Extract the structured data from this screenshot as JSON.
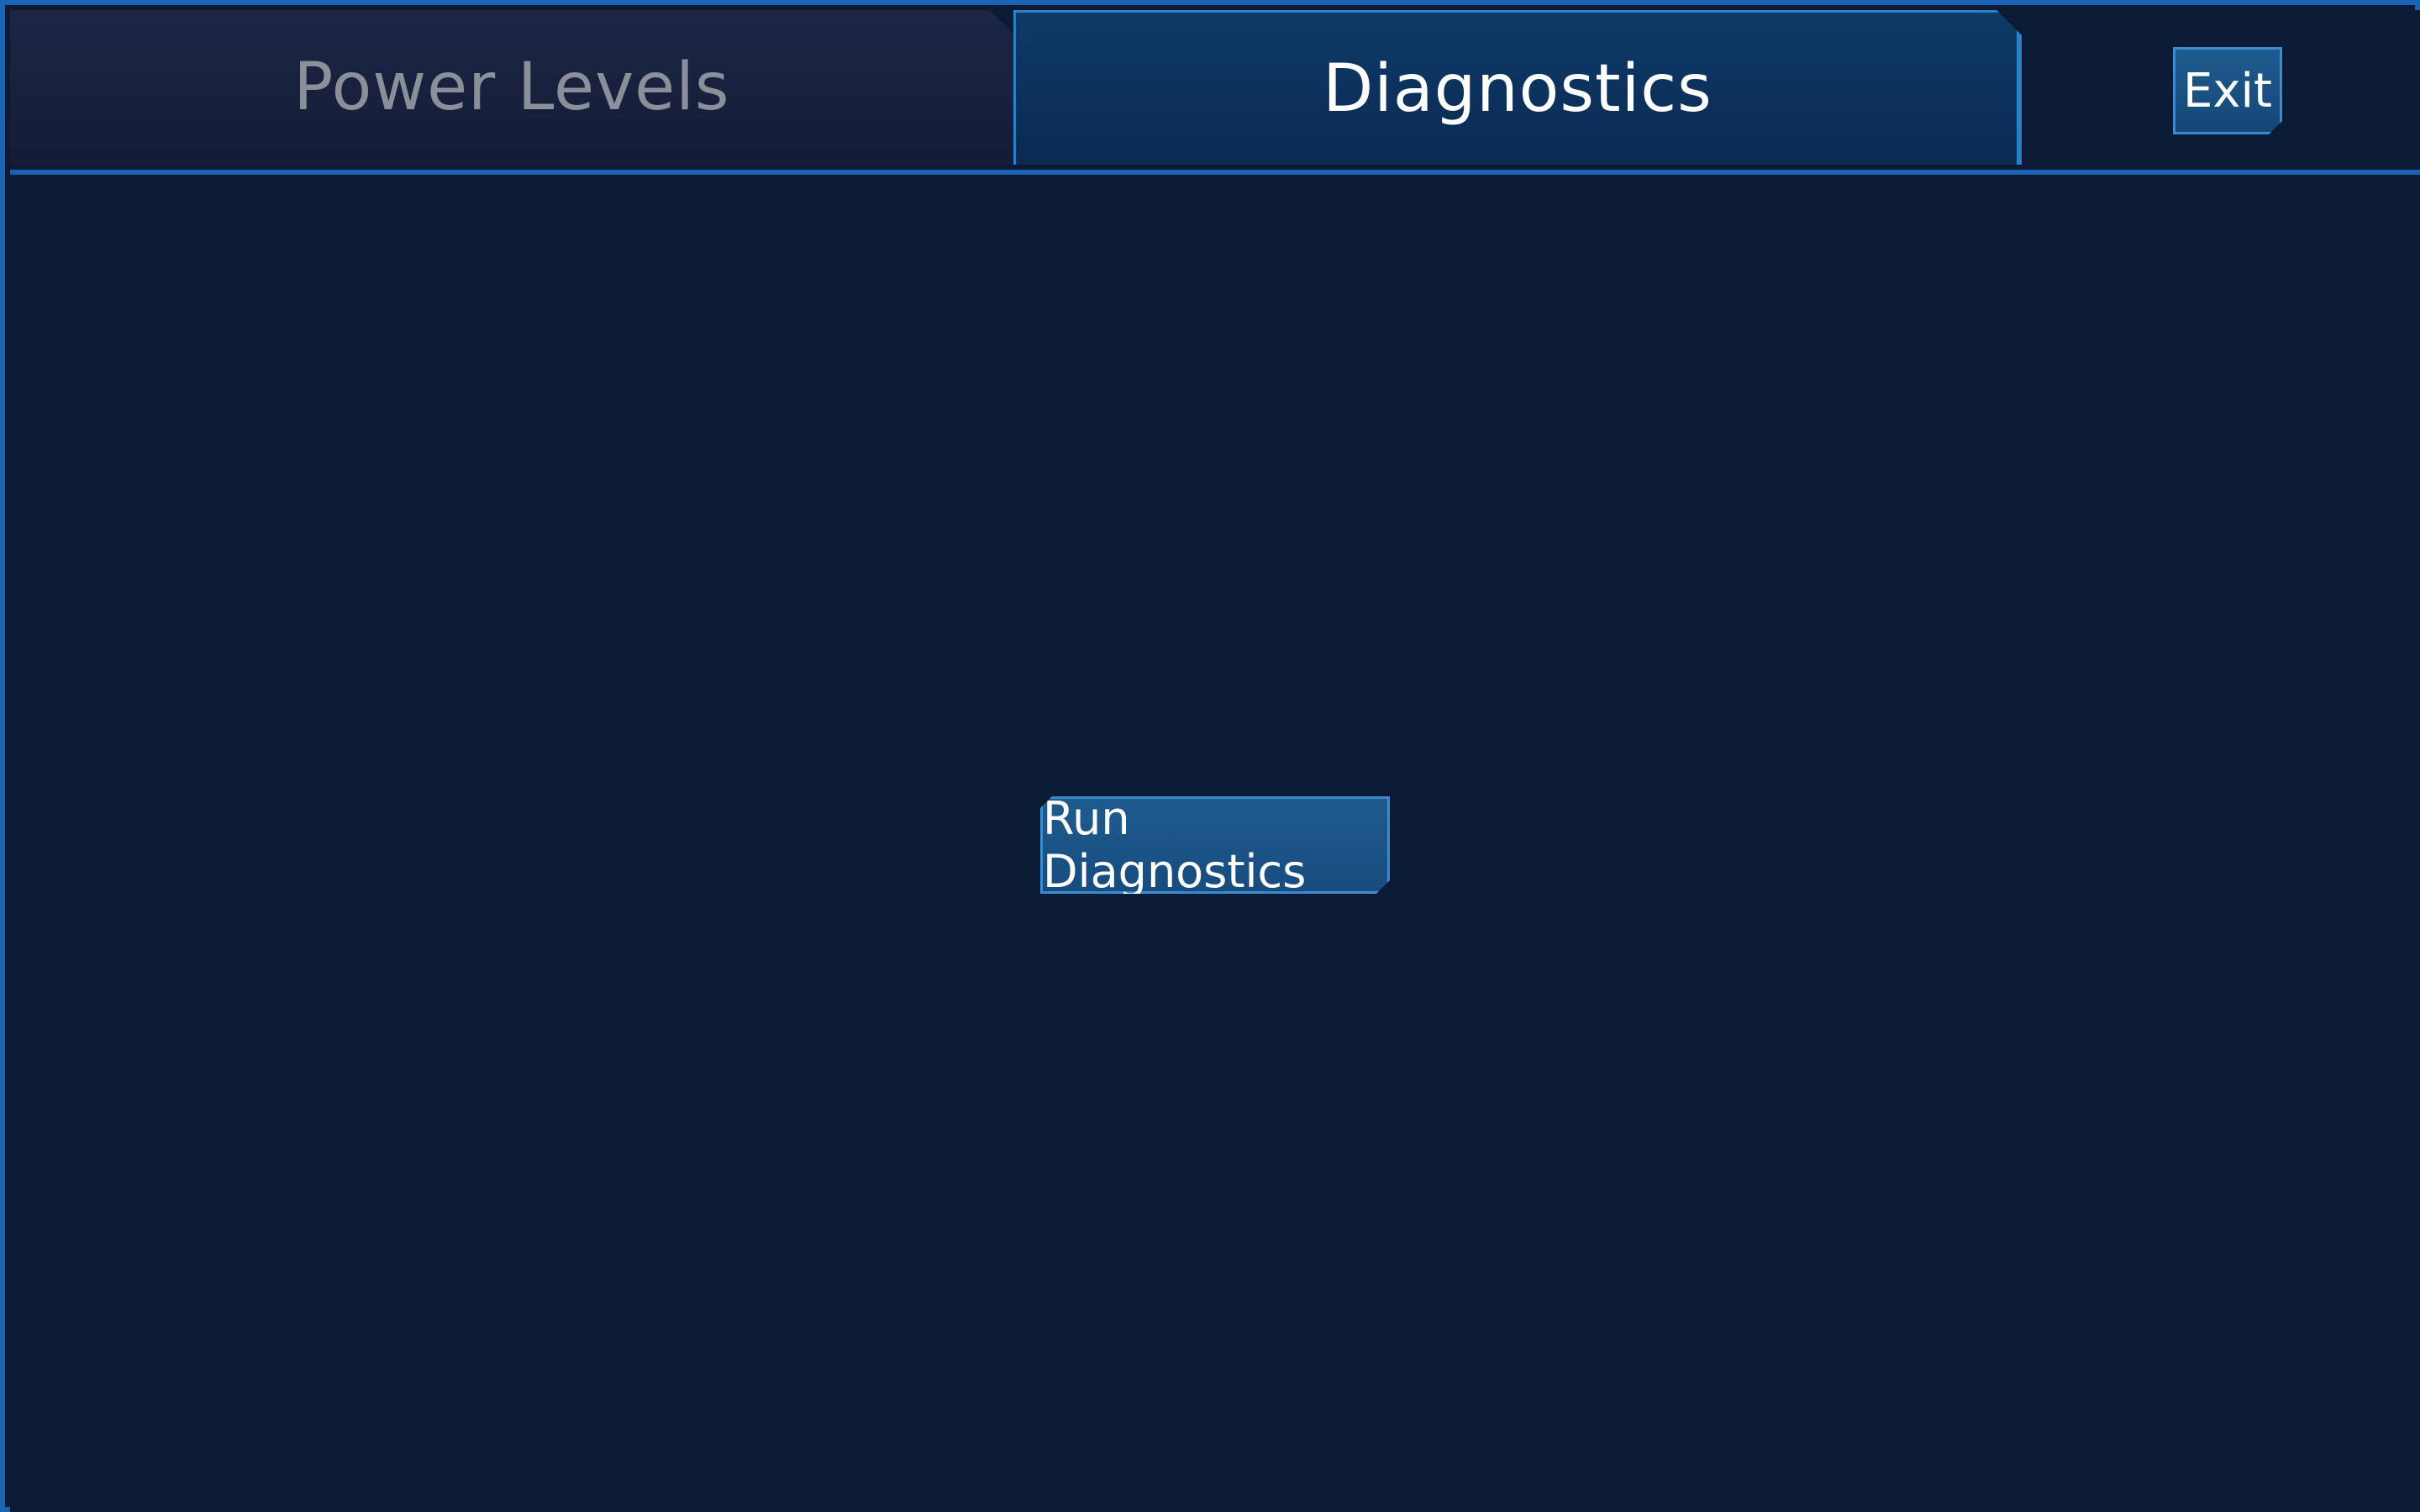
{
  "tabs": [
    {
      "label": "Power Levels",
      "active": false
    },
    {
      "label": "Diagnostics",
      "active": true
    }
  ],
  "header": {
    "exit_label": "Exit"
  },
  "main": {
    "run_button_label": "Run Diagnostics"
  },
  "colors": {
    "background": "#0b1a35",
    "border": "#1a64b6",
    "active_tab": "#0e3a68",
    "inactive_tab": "#1c2645",
    "button": "#1f5b8f"
  }
}
